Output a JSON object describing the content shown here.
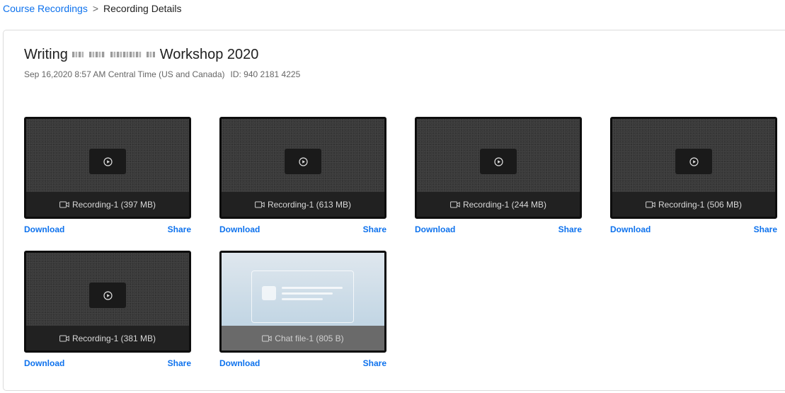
{
  "breadcrumb": {
    "parent": "Course Recordings",
    "separator": ">",
    "current": "Recording Details"
  },
  "meeting": {
    "title_prefix": "Writing",
    "title_suffix": "Workshop 2020",
    "datetime": "Sep 16,2020 8:57 AM Central Time (US and Canada)",
    "id": "ID: 940 2181 4225"
  },
  "recordings": [
    {
      "type": "video",
      "label": "Recording-1 (397 MB)",
      "download": "Download",
      "share": "Share"
    },
    {
      "type": "video",
      "label": "Recording-1 (613 MB)",
      "download": "Download",
      "share": "Share"
    },
    {
      "type": "video",
      "label": "Recording-1 (244 MB)",
      "download": "Download",
      "share": "Share"
    },
    {
      "type": "video",
      "label": "Recording-1 (506 MB)",
      "download": "Download",
      "share": "Share"
    },
    {
      "type": "video",
      "label": "Recording-1 (381 MB)",
      "download": "Download",
      "share": "Share"
    },
    {
      "type": "chat",
      "label": "Chat file-1 (805 B)",
      "download": "Download",
      "share": "Share"
    }
  ],
  "icons": {
    "play": "play-circle-icon",
    "video": "video-camera-icon"
  },
  "colors": {
    "link": "#0e72ed",
    "thumb_bg": "#3a3a3a",
    "caption_bg": "#212121"
  }
}
